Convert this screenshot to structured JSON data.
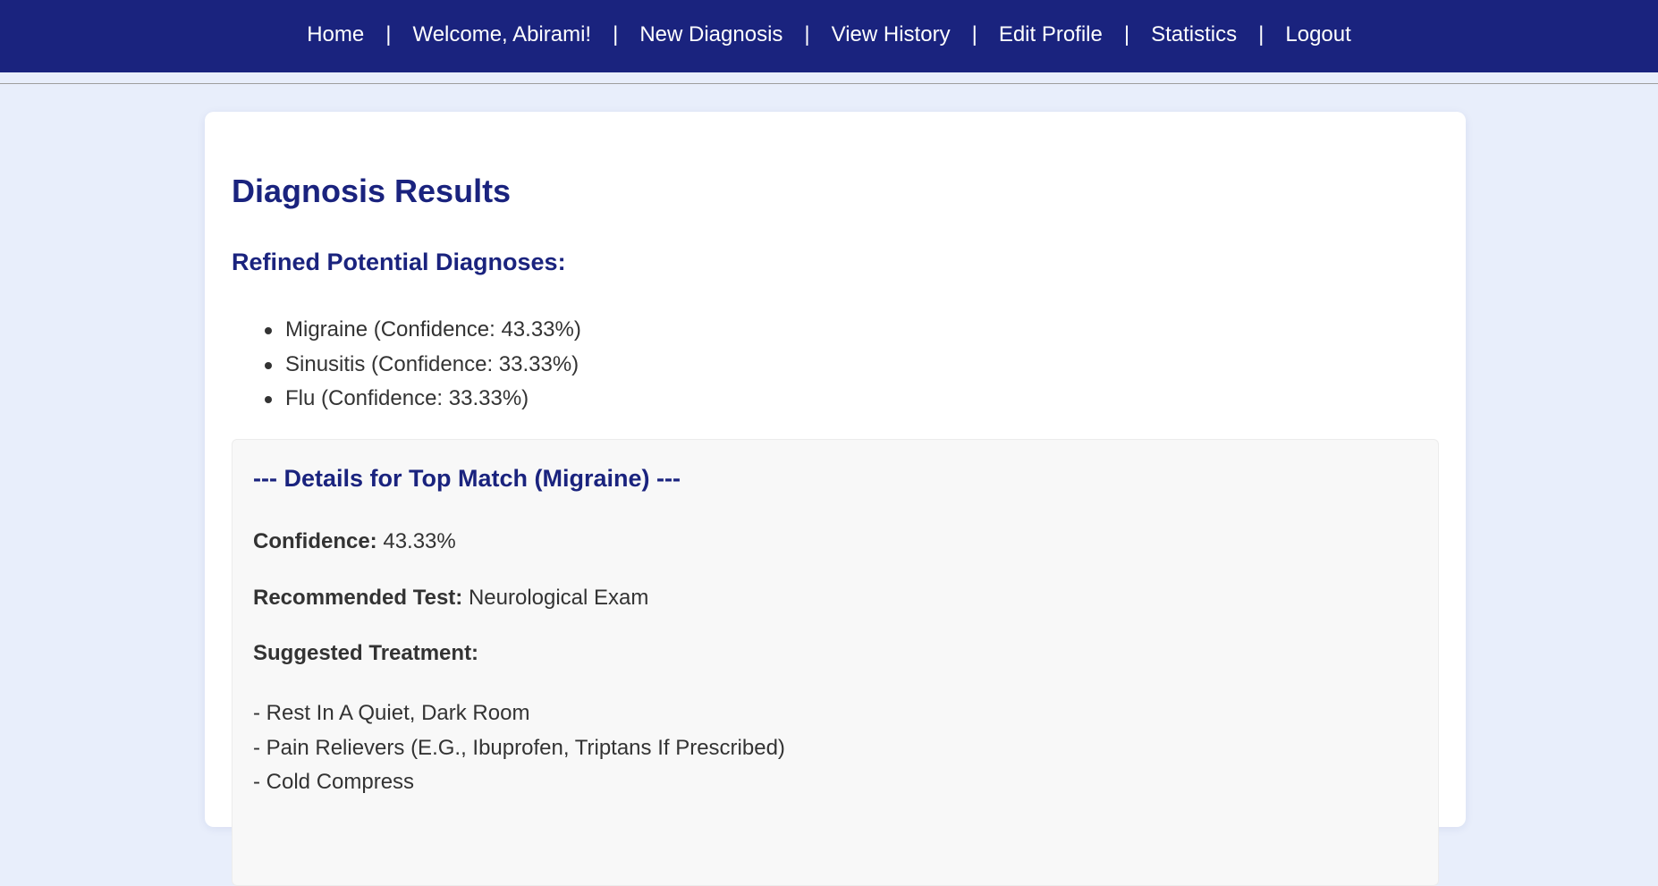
{
  "nav": {
    "items": [
      {
        "label": "Home"
      },
      {
        "label": "Welcome, Abirami!"
      },
      {
        "label": "New Diagnosis"
      },
      {
        "label": "View History"
      },
      {
        "label": "Edit Profile"
      },
      {
        "label": "Statistics"
      },
      {
        "label": "Logout"
      }
    ],
    "separator": "|"
  },
  "main": {
    "title": "Diagnosis Results",
    "diagnoses_heading": "Refined Potential Diagnoses:",
    "diagnoses": [
      {
        "text": "Migraine (Confidence: 43.33%)"
      },
      {
        "text": "Sinusitis (Confidence: 33.33%)"
      },
      {
        "text": "Flu (Confidence: 33.33%)"
      }
    ],
    "details": {
      "heading": "--- Details for Top Match (Migraine) ---",
      "confidence_label": "Confidence:",
      "confidence_value": "43.33%",
      "test_label": "Recommended Test:",
      "test_value": "Neurological Exam",
      "treatment_label": "Suggested Treatment:",
      "treatments": [
        "- Rest In A Quiet, Dark Room",
        "- Pain Relievers (E.G., Ibuprofen, Triptans If Prescribed)",
        "- Cold Compress"
      ]
    }
  },
  "colors": {
    "navbar": "#1a237e",
    "heading": "#1a237e",
    "page_background": "#e8eefb",
    "card_background": "#ffffff",
    "details_background": "#f8f8f8"
  }
}
